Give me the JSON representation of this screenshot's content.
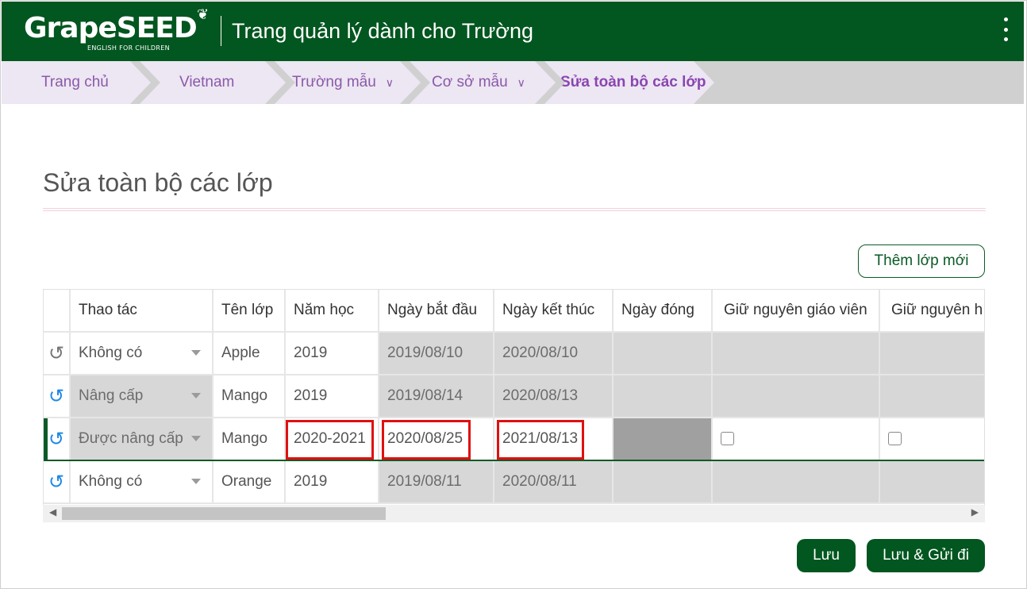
{
  "header": {
    "logo_text": "GrapeSEED",
    "logo_tagline": "ENGLISH FOR CHILDREN",
    "app_title": "Trang quản lý dành cho Trường"
  },
  "breadcrumb": [
    {
      "label": "Trang chủ"
    },
    {
      "label": "Vietnam"
    },
    {
      "label": "Trường mẫu",
      "dropdown": true
    },
    {
      "label": "Cơ sở mẫu",
      "dropdown": true
    },
    {
      "label": "Sửa toàn bộ các lớp",
      "active": true
    }
  ],
  "page": {
    "title": "Sửa toàn bộ các lớp",
    "add_button": "Thêm lớp mới"
  },
  "table": {
    "columns": [
      "Thao tác",
      "Tên lớp",
      "Năm học",
      "Ngày bắt đầu",
      "Ngày kết thúc",
      "Ngày đóng",
      "Giữ nguyên giáo viên",
      "Giữ nguyên h"
    ],
    "rows": [
      {
        "action": "Không có",
        "class_name": "Apple",
        "school_year": "2019",
        "start": "2019/08/10",
        "end": "2020/08/10"
      },
      {
        "action": "Nâng cấp",
        "class_name": "Mango",
        "school_year": "2019",
        "start": "2019/08/14",
        "end": "2020/08/13"
      },
      {
        "action": "Được nâng cấp",
        "class_name": "Mango",
        "school_year": "2020-2021",
        "start": "2020/08/25",
        "end": "2021/08/13",
        "selected": true
      },
      {
        "action": "Không có",
        "class_name": "Orange",
        "school_year": "2019",
        "start": "2019/08/11",
        "end": "2020/08/11"
      }
    ]
  },
  "footer": {
    "save": "Lưu",
    "save_send": "Lưu & Gửi đi"
  },
  "colors": {
    "brand_green": "#02561f",
    "breadcrumb_purple": "#8a5aa8",
    "highlight_red": "#e01010",
    "undo_blue": "#1e88e5"
  }
}
